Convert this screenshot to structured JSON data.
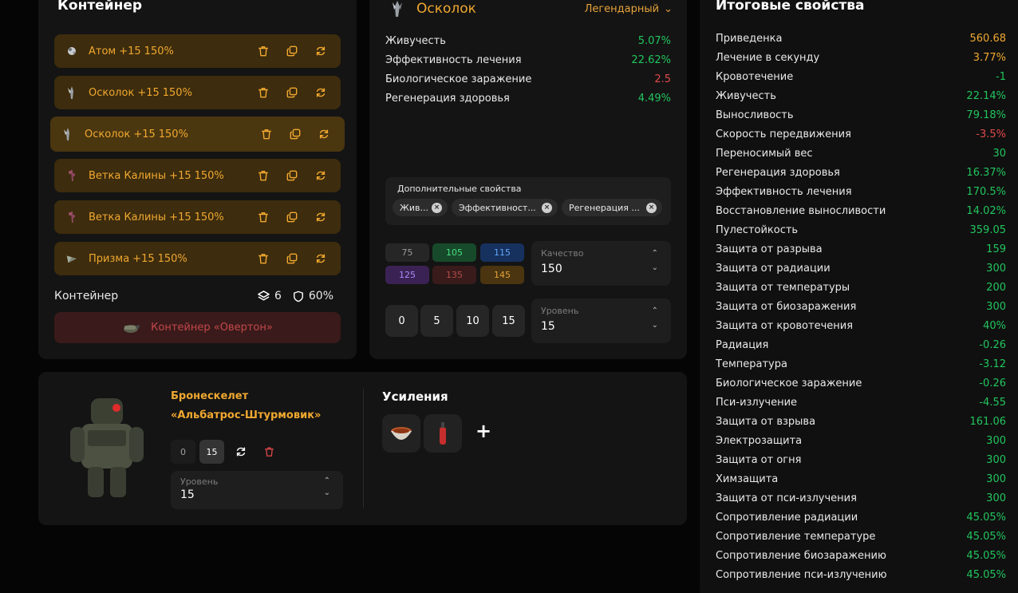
{
  "container": {
    "title": "Контейнер",
    "items": [
      {
        "name": "Атом",
        "bonus": "+15",
        "percent": "150%",
        "icon": "atom-artifact-icon"
      },
      {
        "name": "Осколок",
        "bonus": "+15",
        "percent": "150%",
        "icon": "shard-artifact-icon"
      },
      {
        "name": "Осколок",
        "bonus": "+15",
        "percent": "150%",
        "icon": "shard-artifact-icon"
      },
      {
        "name": "Ветка Калины",
        "bonus": "+15",
        "percent": "150%",
        "icon": "viburnum-branch-icon"
      },
      {
        "name": "Ветка Калины",
        "bonus": "+15",
        "percent": "150%",
        "icon": "viburnum-branch-icon"
      },
      {
        "name": "Призма",
        "bonus": "+15",
        "percent": "150%",
        "icon": "prism-artifact-icon"
      }
    ],
    "footer_label": "Контейнер",
    "slots": "6",
    "protection": "60%",
    "container_button": "Контейнер «Овертон»"
  },
  "artifact": {
    "name": "Осколок",
    "rarity": "Легендарный",
    "properties": [
      {
        "label": "Живучесть",
        "value": "5.07%",
        "color": "green"
      },
      {
        "label": "Эффективность лечения",
        "value": "22.62%",
        "color": "green"
      },
      {
        "label": "Биологическое заражение",
        "value": "2.5",
        "color": "red"
      },
      {
        "label": "Регенерация здоровья",
        "value": "4.49%",
        "color": "green"
      }
    ],
    "extra_title": "Дополнительные свойства",
    "extra_chips": [
      "Жив...",
      "Эффективност...",
      "Регенерация ..."
    ],
    "quality_presets": [
      {
        "label": "75",
        "bg": "#262626",
        "fg": "#9a9a9a"
      },
      {
        "label": "105",
        "bg": "#174a2a",
        "fg": "#4ade80"
      },
      {
        "label": "115",
        "bg": "#16315e",
        "fg": "#60a5fa"
      },
      {
        "label": "125",
        "bg": "#3b2254",
        "fg": "#a78bfa"
      },
      {
        "label": "135",
        "bg": "#3a1b1b",
        "fg": "#b44a4a"
      },
      {
        "label": "145",
        "bg": "#4a3510",
        "fg": "#e6a23a"
      }
    ],
    "quality_label": "Качество",
    "quality_value": "150",
    "level_presets": [
      "0",
      "5",
      "10",
      "15"
    ],
    "level_label": "Уровень",
    "level_value": "15"
  },
  "armor": {
    "name_line1": "Бронескелет",
    "name_line2": "«Альбатрос-Штурмовик»",
    "level_buttons": [
      "0",
      "15"
    ],
    "level_label": "Уровень",
    "level_value": "15",
    "boosts_title": "Усиления",
    "add_symbol": "+"
  },
  "totals": {
    "title": "Итоговые свойства",
    "rows": [
      {
        "label": "Приведенка",
        "value": "560.68",
        "color": "orange"
      },
      {
        "label": "Лечение в секунду",
        "value": "3.77%",
        "color": "orange"
      },
      {
        "label": "Кровотечение",
        "value": "-1",
        "color": "green"
      },
      {
        "label": "Живучесть",
        "value": "22.14%",
        "color": "green"
      },
      {
        "label": "Выносливость",
        "value": "79.18%",
        "color": "green"
      },
      {
        "label": "Скорость передвижения",
        "value": "-3.5%",
        "color": "red"
      },
      {
        "label": "Переносимый вес",
        "value": "30",
        "color": "green"
      },
      {
        "label": "Регенерация здоровья",
        "value": "16.37%",
        "color": "green"
      },
      {
        "label": "Эффективность лечения",
        "value": "170.5%",
        "color": "green"
      },
      {
        "label": "Восстановление выносливости",
        "value": "14.02%",
        "color": "green"
      },
      {
        "label": "Пулестойкость",
        "value": "359.05",
        "color": "green"
      },
      {
        "label": "Защита от разрыва",
        "value": "159",
        "color": "green"
      },
      {
        "label": "Защита от радиации",
        "value": "300",
        "color": "green"
      },
      {
        "label": "Защита от температуры",
        "value": "200",
        "color": "green"
      },
      {
        "label": "Защита от биозаражения",
        "value": "300",
        "color": "green"
      },
      {
        "label": "Защита от кровотечения",
        "value": "40%",
        "color": "green"
      },
      {
        "label": "Радиация",
        "value": "-0.26",
        "color": "green"
      },
      {
        "label": "Температура",
        "value": "-3.12",
        "color": "green"
      },
      {
        "label": "Биологическое заражение",
        "value": "-0.26",
        "color": "green"
      },
      {
        "label": "Пси-излучение",
        "value": "-4.55",
        "color": "green"
      },
      {
        "label": "Защита от взрыва",
        "value": "161.06",
        "color": "green"
      },
      {
        "label": "Электрозащита",
        "value": "300",
        "color": "green"
      },
      {
        "label": "Защита от огня",
        "value": "300",
        "color": "green"
      },
      {
        "label": "Химзащита",
        "value": "300",
        "color": "green"
      },
      {
        "label": "Защита от пси-излучения",
        "value": "300",
        "color": "green"
      },
      {
        "label": "Сопротивление радиации",
        "value": "45.05%",
        "color": "green"
      },
      {
        "label": "Сопротивление температуре",
        "value": "45.05%",
        "color": "green"
      },
      {
        "label": "Сопротивление биозаражению",
        "value": "45.05%",
        "color": "green"
      },
      {
        "label": "Сопротивление пси-излучению",
        "value": "45.05%",
        "color": "green"
      }
    ]
  },
  "colors": {
    "accent": "#f0a830",
    "green": "#22c55e",
    "red": "#e0494b",
    "panel": "#141414"
  }
}
